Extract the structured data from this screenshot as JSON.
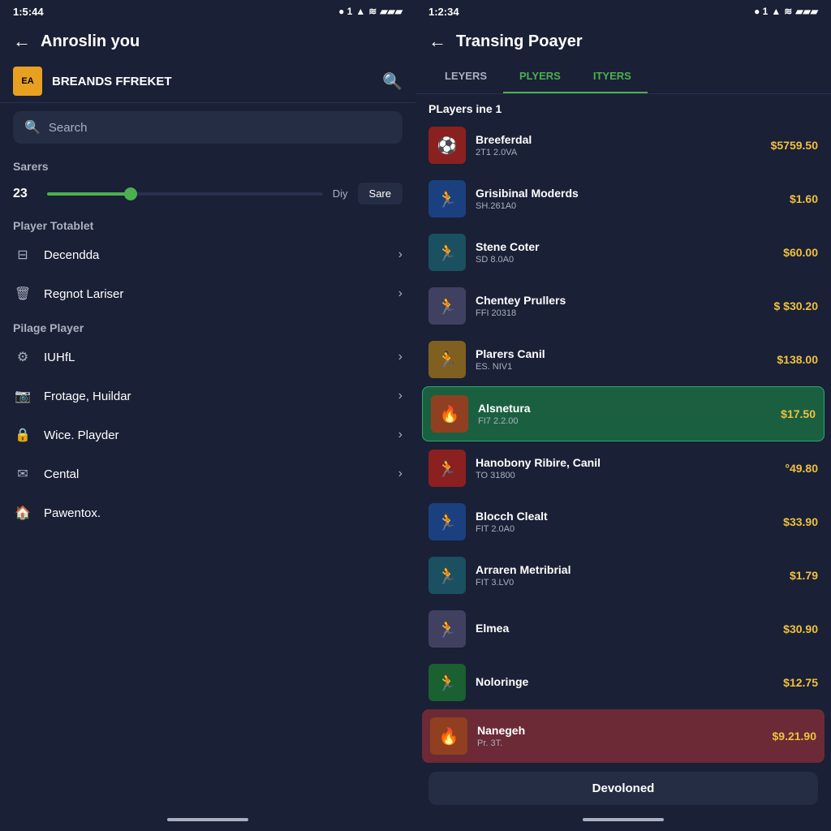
{
  "left": {
    "status_time": "1:5:44",
    "status_icons": "● 1 ▲ ≋ 🔋",
    "back_label": "←",
    "title": "Anroslin you",
    "ea_logo": "EA",
    "ea_title": "BREANDS FFREKET",
    "search_placeholder": "Search",
    "section_savers": "Sarers",
    "slider_left": "23",
    "slider_right": "Diy",
    "save_btn": "Sare",
    "section_player": "Player Totablet",
    "menu_items": [
      {
        "icon": "⊟",
        "label": "Decendda"
      },
      {
        "icon": "🗑",
        "label": "Regnot Lariser"
      }
    ],
    "section_pilage": "Pilage Player",
    "menu_items2": [
      {
        "icon": "⚙",
        "label": "IUHfL"
      },
      {
        "icon": "📷",
        "label": "Frotage, Huildar"
      },
      {
        "icon": "🔒",
        "label": "Wice. Playder"
      },
      {
        "icon": "✉",
        "label": "Cental"
      },
      {
        "icon": "🏠",
        "label": "Pawentox."
      }
    ]
  },
  "right": {
    "status_time": "1:2:34",
    "status_icons": "● 1 ▲ ≋ 🔋",
    "back_label": "←",
    "title": "Transing Poayer",
    "tabs": [
      {
        "label": "LEYERS",
        "active": false
      },
      {
        "label": "PLYERS",
        "active": true
      },
      {
        "label": "ITYERS",
        "active": true
      }
    ],
    "players_section": "PLayers ine 1",
    "players": [
      {
        "name": "Breeferdal",
        "sub": "2T1 2.0VA",
        "price": "$5759.50",
        "av": "av-red",
        "emoji": "⚽"
      },
      {
        "name": "Grisibinal Moderds",
        "sub": "SH.261A0",
        "price": "$1.60",
        "av": "av-blue",
        "emoji": "🏃"
      },
      {
        "name": "Stene Coter",
        "sub": "SD 8.0A0",
        "price": "$60.00",
        "av": "av-teal",
        "emoji": "🏃"
      },
      {
        "name": "Chentey Prullers",
        "sub": "FFI 20318",
        "price": "$ $30.20",
        "av": "av-gray",
        "emoji": "🏃"
      },
      {
        "name": "Plarers Canil",
        "sub": "ES. NIV1",
        "price": "$138.00",
        "av": "av-yellow",
        "emoji": "🏃"
      },
      {
        "name": "Alsnetura",
        "sub": "FI7 2.2.00",
        "price": "$17.50",
        "av": "av-orange",
        "emoji": "🔥",
        "highlighted": true
      },
      {
        "name": "Hanobony Ribire, Canil",
        "sub": "TO 31800",
        "price": "°49.80",
        "av": "av-red",
        "emoji": "🏃"
      },
      {
        "name": "Blocch Clealt",
        "sub": "FIT 2.0A0",
        "price": "$33.90",
        "av": "av-blue",
        "emoji": "🏃"
      },
      {
        "name": "Arraren Metribrial",
        "sub": "FIT 3.LV0",
        "price": "$1.79",
        "av": "av-teal",
        "emoji": "🏃"
      },
      {
        "name": "Elmea",
        "sub": "",
        "price": "$30.90",
        "av": "av-gray",
        "emoji": "🏃"
      },
      {
        "name": "Noloringe",
        "sub": "",
        "price": "$12.75",
        "av": "av-green",
        "emoji": "🏃"
      },
      {
        "name": "Nanegeh",
        "sub": "Pr. 3T.",
        "price": "$9.21.90",
        "av": "av-orange",
        "emoji": "🔥",
        "last": true
      }
    ],
    "toast": "Devoloned"
  }
}
